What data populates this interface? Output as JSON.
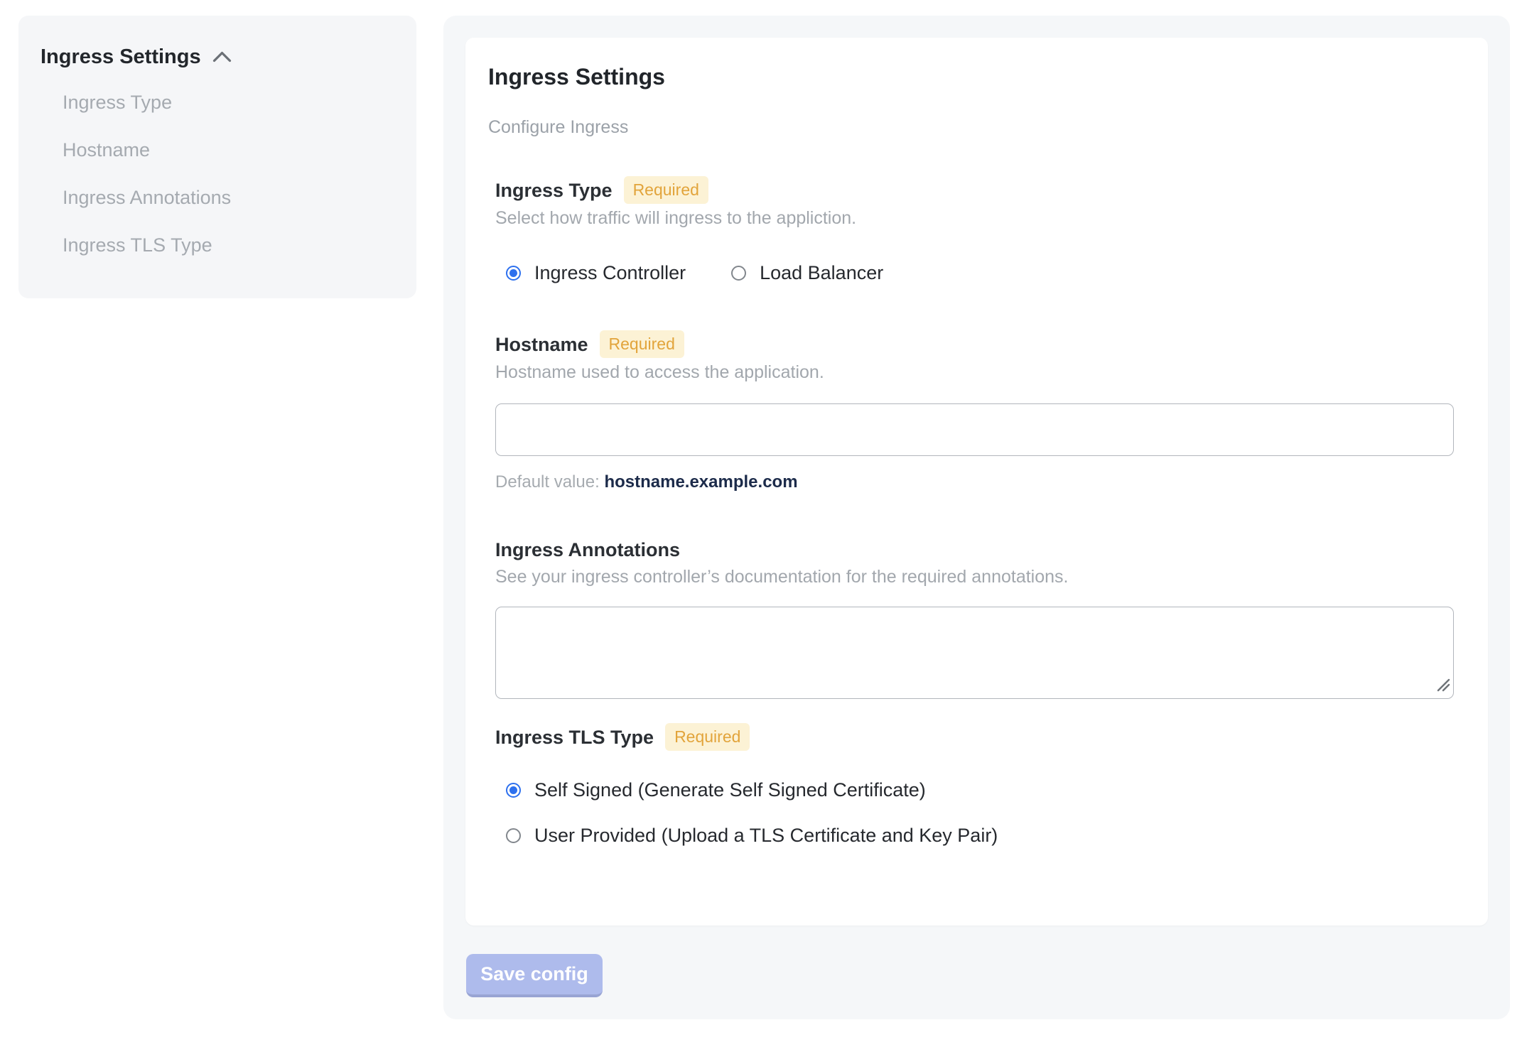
{
  "sidebar": {
    "header": {
      "label": "Ingress Settings",
      "icon": "chevron-up"
    },
    "items": [
      {
        "label": "Ingress Type"
      },
      {
        "label": "Hostname"
      },
      {
        "label": "Ingress Annotations"
      },
      {
        "label": "Ingress TLS Type"
      }
    ]
  },
  "panel": {
    "title": "Ingress Settings",
    "subtitle": "Configure Ingress",
    "required_badge": "Required",
    "sections": {
      "ingress_type": {
        "label": "Ingress Type",
        "required": true,
        "help": "Select how traffic will ingress to the appliction.",
        "options": [
          {
            "label": "Ingress Controller",
            "selected": true
          },
          {
            "label": "Load Balancer",
            "selected": false
          }
        ]
      },
      "hostname": {
        "label": "Hostname",
        "required": true,
        "help": "Hostname used to access the application.",
        "value": "",
        "default_label": "Default value:",
        "default_value": "hostname.example.com"
      },
      "annotations": {
        "label": "Ingress Annotations",
        "required": false,
        "help": "See your ingress controller’s documentation for the required annotations.",
        "value": ""
      },
      "tls": {
        "label": "Ingress TLS Type",
        "required": true,
        "options": [
          {
            "label": "Self Signed (Generate Self Signed Certificate)",
            "selected": true
          },
          {
            "label": "User Provided (Upload a TLS Certificate and Key Pair)",
            "selected": false
          }
        ]
      }
    },
    "save_button_label": "Save config"
  },
  "colors": {
    "accent_blue": "#2d70ee",
    "badge_bg": "#fcf2d5",
    "badge_text": "#e2a43b",
    "panel_bg": "#f5f7f9",
    "sidebar_bg": "#f5f6f8",
    "save_button_bg": "#aebbec",
    "save_button_edge": "#98a4d3",
    "default_value_text": "#1c2b4a"
  }
}
